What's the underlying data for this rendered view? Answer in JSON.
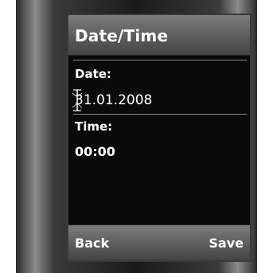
{
  "title": "Date/Time",
  "date": {
    "label": "Date:",
    "value": "31.01.2008"
  },
  "time": {
    "label": "Time:",
    "value": "00:00"
  },
  "softkeys": {
    "left": "Back",
    "right": "Save"
  },
  "colors": {
    "screen_background": "#0a0a0a",
    "bar_gradient_top": "#7c7c7c",
    "bar_gradient_bottom": "#444444",
    "text": "#ffffff"
  },
  "icons": {
    "cursor": "text-cursor-icon"
  }
}
